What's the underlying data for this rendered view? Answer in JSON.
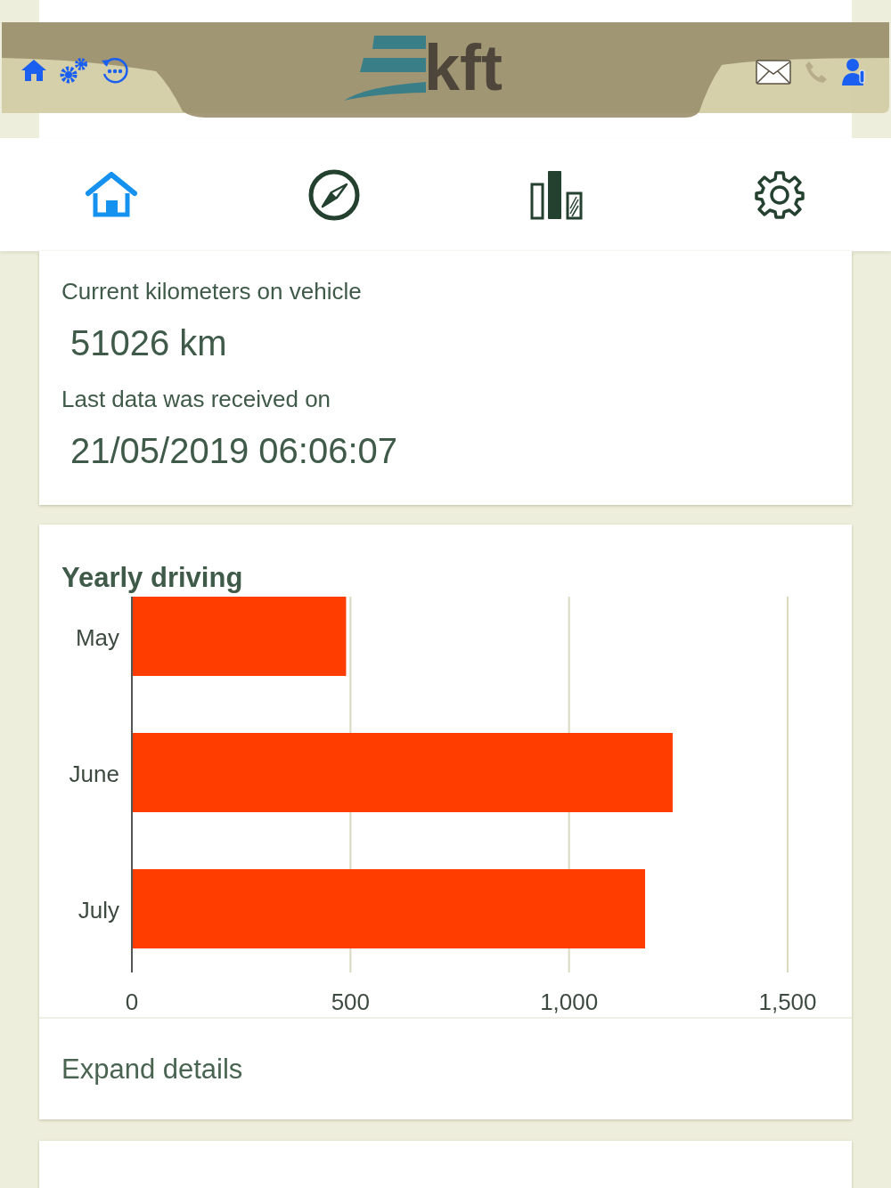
{
  "header": {
    "logo": "kft",
    "left_icons": [
      {
        "kind": "home"
      },
      {
        "kind": "gears"
      },
      {
        "kind": "refresh"
      }
    ],
    "right_icons": [
      {
        "kind": "mail",
        "disabled": false
      },
      {
        "kind": "phone",
        "disabled": true
      },
      {
        "kind": "user",
        "disabled": false
      }
    ]
  },
  "nav_tabs": [
    {
      "kind": "home",
      "selected": true
    },
    {
      "kind": "compass",
      "selected": false
    },
    {
      "kind": "chart",
      "selected": false
    },
    {
      "kind": "settings",
      "selected": false
    }
  ],
  "vehicle_card": {
    "km_label": "Current kilometers on vehicle",
    "km_value": "51026 km",
    "date_label": "Last data was received on",
    "date_value": "21/05/2019 06:06:07"
  },
  "driving_card": {
    "title": "Yearly driving",
    "link": "Expand details",
    "chart_data": {
      "type": "bar",
      "orientation": "horizontal",
      "categories": [
        "May",
        "June",
        "July"
      ],
      "series": [
        {
          "color": "#ff3d00",
          "values": [
            490,
            1237,
            1174
          ]
        }
      ],
      "xlim": [
        0,
        1500
      ],
      "xticks": [
        {
          "value": 0,
          "label": "0"
        },
        {
          "value": 500,
          "label": "500"
        },
        {
          "value": 1000,
          "label": "1,000"
        },
        {
          "value": 1500,
          "label": "1,500"
        }
      ]
    }
  }
}
